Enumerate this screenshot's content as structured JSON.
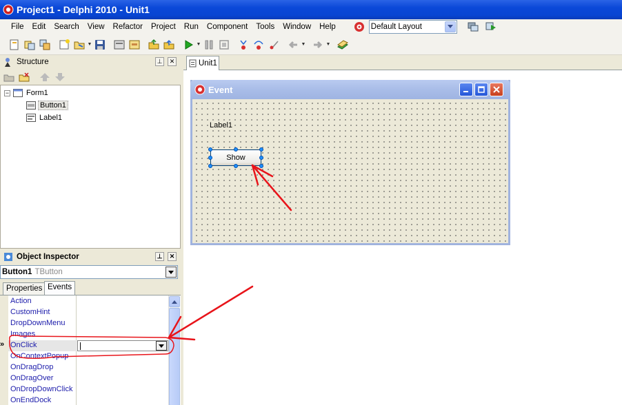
{
  "window": {
    "title": "Project1 - Delphi 2010 - Unit1"
  },
  "menu": {
    "items": [
      "File",
      "Edit",
      "Search",
      "View",
      "Refactor",
      "Project",
      "Run",
      "Component",
      "Tools",
      "Window",
      "Help"
    ],
    "layout_value": "Default Layout"
  },
  "structure": {
    "title": "Structure",
    "tree": {
      "root": "Form1",
      "children": [
        "Button1",
        "Label1"
      ]
    }
  },
  "inspector": {
    "title": "Object Inspector",
    "component_name": "Button1",
    "component_type": "TButton",
    "tabs": [
      "Properties",
      "Events"
    ],
    "active_tab": "Events",
    "events": [
      "Action",
      "CustomHint",
      "DropDownMenu",
      "Images",
      "OnClick",
      "OnContextPopup",
      "OnDragDrop",
      "OnDragOver",
      "OnDropDownClick",
      "OnEndDock"
    ],
    "selected_event": "OnClick",
    "row_marker": "»"
  },
  "editor": {
    "tab": "Unit1",
    "form": {
      "caption": "Event",
      "label_text": "Label1",
      "button_caption": "Show"
    }
  },
  "colors": {
    "annotation": "#e8141a",
    "titlebar": "#0a48d8"
  }
}
